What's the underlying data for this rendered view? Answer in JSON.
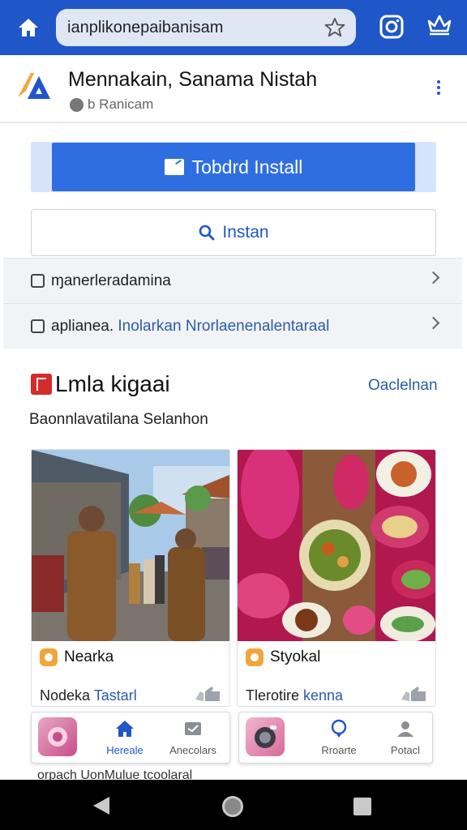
{
  "browser": {
    "url": "ianplikonepaibanisam"
  },
  "site": {
    "title": "Mennakain, Sanama Nistah",
    "subtitle": "b Ranicam"
  },
  "actions": {
    "install_label": "Tobdrd Install",
    "instan_label": "Instan"
  },
  "rows": [
    {
      "label": "ɱanerleradamina",
      "extra": ""
    },
    {
      "label": "aplianea.",
      "extra": " Inolarkan Nrorlaenenalentaraal"
    }
  ],
  "section": {
    "title": "Lmla kigaai",
    "link": "Oaclelnan",
    "subtitle": "Baonnlavatilana Selanhon"
  },
  "cards": [
    {
      "title": "Nearka",
      "sub_dark": "Nodeka ",
      "sub_blue": "Tastarl"
    },
    {
      "title": "Styokal",
      "sub_dark": "Tlerotire ",
      "sub_blue": "kenna"
    }
  ],
  "dock": [
    {
      "items": [
        {
          "label": "Hereale",
          "icon": "home-icon",
          "active": true
        },
        {
          "label": "Anecolars",
          "icon": "inbox-icon",
          "active": false
        }
      ]
    },
    {
      "items": [
        {
          "label": "Rroarte",
          "icon": "location-icon",
          "active": false
        },
        {
          "label": "Potacl",
          "icon": "person-icon",
          "active": false
        }
      ]
    }
  ],
  "footer": {
    "text": "orpach UonMulue tcoolaral"
  },
  "colors": {
    "accent": "#1f56c8",
    "install": "#2f6ee0",
    "link": "#2a5ca8",
    "section_icon": "#d42b2b"
  }
}
